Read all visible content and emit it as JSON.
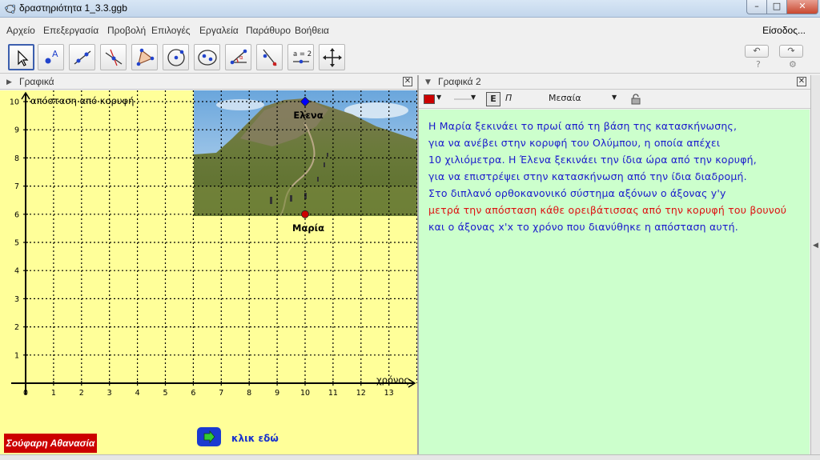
{
  "window": {
    "title": "δραστηριότητα 1_3.3.ggb"
  },
  "menubar": {
    "items": [
      "Αρχείο",
      "Επεξεργασία",
      "Προβολή",
      "Επιλογές",
      "Εργαλεία",
      "Παράθυρο",
      "Βοήθεια"
    ],
    "login": "Είσοδος..."
  },
  "toolbar": {
    "tools": [
      "move-tool",
      "point-tool",
      "line-tool",
      "perpendicular-line-tool",
      "polygon-tool",
      "circle-tool",
      "conic-tool",
      "angle-tool",
      "reflect-tool",
      "slider-tool",
      "move-graphics-view-tool"
    ],
    "slider_tool_label": "a = 2"
  },
  "panels": {
    "left_title": "Γραφικά",
    "right_title": "Γραφικά 2"
  },
  "right_toolbar": {
    "bold_label": "Ε",
    "italic_label": "Π",
    "size_label": "Μεσαία",
    "text_color": "#cc0000"
  },
  "graph": {
    "ylabel": "απόσταση από κορυφή",
    "xlabel": "χρόνος",
    "x_ticks": [
      "0",
      "1",
      "2",
      "3",
      "4",
      "5",
      "6",
      "7",
      "8",
      "9",
      "10",
      "11",
      "12",
      "13"
    ],
    "y_ticks": [
      "1",
      "2",
      "3",
      "4",
      "5",
      "6",
      "7",
      "8",
      "9",
      "10"
    ],
    "background": "#ffff99",
    "points": [
      {
        "label": "Ελενα",
        "x": 10,
        "y": 10,
        "color": "#0000ff"
      },
      {
        "label": "Μαρία",
        "x": 10,
        "y": 6,
        "color": "#cc0000"
      }
    ]
  },
  "text_lines": [
    {
      "text": "Η Μαρία ξεκινάει το πρωί από τη βάση της κατασκήνωσης,",
      "color": "#1a1acc"
    },
    {
      "text": "για να ανέβει στην κορυφή του Ολύμπου,  η οποία απέχει",
      "color": "#1a1acc"
    },
    {
      "text": "10 χιλιόμετρα.  Η  Έλενα ξεκινάει την ίδια ώρα από την κορυφή,",
      "color": "#1a1acc"
    },
    {
      "text": "για να επιστρέψει στην κατασκήνωση από την ίδια διαδρομή.",
      "color": "#1a1acc"
    },
    {
      "text": "Στο διπλανό ορθοκανονικό σύστημα αξόνων ο άξονας y'y",
      "color": "#1a1acc"
    },
    {
      "text": "μετρά την απόσταση κάθε ορειβάτισσας από την κορυφή του βουνού",
      "color": "#dd1111"
    },
    {
      "text": "και ο άξονας x'x το χρόνο που διανύθηκε η απόσταση αυτή.",
      "color": "#1a1acc"
    }
  ],
  "footer": {
    "signature": "Σούφαρη Αθανασία",
    "click_label": "κλικ εδώ"
  }
}
